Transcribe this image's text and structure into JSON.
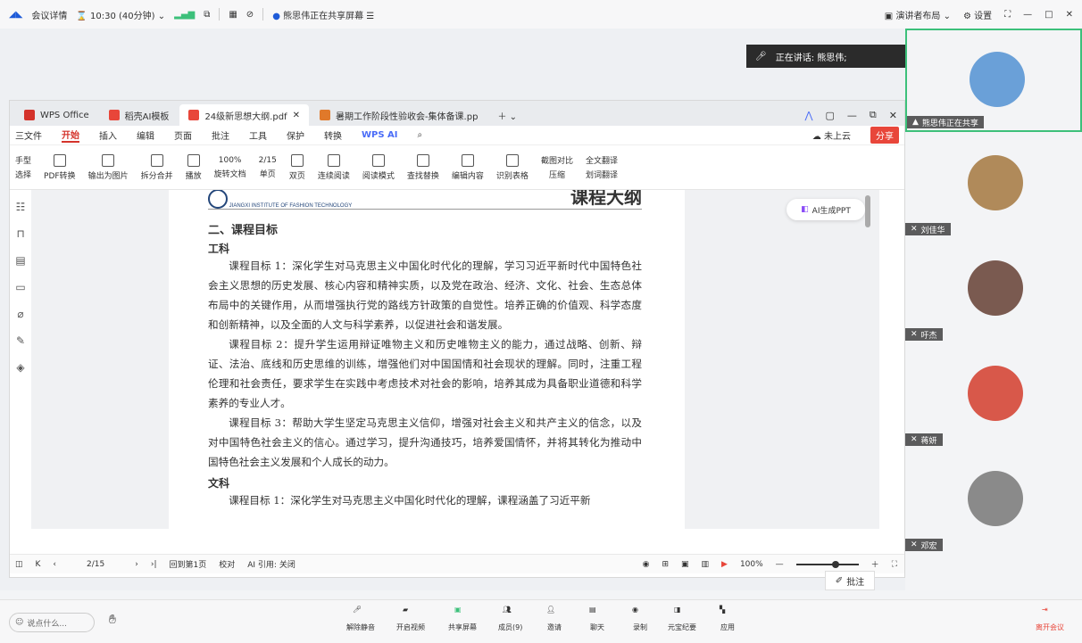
{
  "meeting": {
    "details": "会议详情",
    "time": "10:30 (40分钟)",
    "sharing_status": "熊思伟正在共享屏幕",
    "presenter_layout": "演讲者布局",
    "settings": "设置",
    "speaking_label": "正在讲话: 熊思伟;"
  },
  "wps": {
    "tabs": [
      {
        "label": "WPS Office",
        "color": "#d4332b"
      },
      {
        "label": "稻壳AI模板",
        "color": "#e8463a"
      },
      {
        "label": "24级新思想大纲.pdf",
        "color": "#e8463a"
      },
      {
        "label": "暑期工作阶段性验收会-集体备课.pp",
        "color": "#e0792a"
      }
    ],
    "menu": [
      "三文件",
      "开始",
      "插入",
      "编辑",
      "页面",
      "批注",
      "工具",
      "保护",
      "转换",
      "WPS AI"
    ],
    "menu_active": "开始",
    "not_uploaded": "未上云",
    "share": "分享",
    "toolbar": [
      "手型",
      "选择",
      "PDF转换",
      "输出为图片",
      "拆分合并",
      "播放",
      "旋转文档",
      "单页",
      "双页",
      "连续阅读",
      "阅读模式",
      "查找替换",
      "编辑内容",
      "识别表格",
      "截图对比",
      "压缩",
      "全文翻译",
      "划词翻译"
    ],
    "zoom": "100%",
    "page": "2/15",
    "ai_ppt": "AI生成PPT",
    "status": {
      "page": "2/15",
      "goto": "回到第1页",
      "proof": "校对",
      "ai_cite": "AI 引用: 关闭",
      "zoom": "100%",
      "annotate": "批注"
    }
  },
  "document": {
    "logo_sub": "JIANGXI INSTITUTE OF FASHION TECHNOLOGY",
    "heading": "课程大纲",
    "section": "二、课程目标",
    "sub_gong": "工科",
    "p1": "课程目标 1：深化学生对马克思主义中国化时代化的理解，学习习近平新时代中国特色社会主义思想的历史发展、核心内容和精神实质，以及党在政治、经济、文化、社会、生态总体布局中的关键作用，从而增强执行党的路线方针政策的自觉性。培养正确的价值观、科学态度和创新精神，以及全面的人文与科学素养，以促进社会和谐发展。",
    "p2": "课程目标 2：提升学生运用辩证唯物主义和历史唯物主义的能力，通过战略、创新、辩证、法治、底线和历史思维的训练，增强他们对中国国情和社会现状的理解。同时，注重工程伦理和社会责任，要求学生在实践中考虑技术对社会的影响，培养其成为具备职业道德和科学素养的专业人才。",
    "p3": "课程目标 3：帮助大学生坚定马克思主义信仰，增强对社会主义和共产主义的信念，以及对中国特色社会主义的信心。通过学习，提升沟通技巧，培养爱国情怀，并将其转化为推动中国特色社会主义发展和个人成长的动力。",
    "sub_wen": "文科",
    "p4": "课程目标 1：深化学生对马克思主义中国化时代化的理解，课程涵盖了习近平新"
  },
  "participants": [
    {
      "name": "熊思伟正在共享",
      "color": "#6aa0d8"
    },
    {
      "name": "刘佳华",
      "color": "#b08a5a"
    },
    {
      "name": "吁杰",
      "color": "#7a5a50"
    },
    {
      "name": "蒋妍",
      "color": "#d8584a"
    },
    {
      "name": "邓宏",
      "color": "#8a8a8a"
    }
  ],
  "bottom": {
    "say": "说点什么...",
    "items": [
      "解除静音",
      "开启视频",
      "共享屏幕",
      "成员(9)",
      "邀请",
      "聊天",
      "录制",
      "元宝纪要",
      "应用"
    ],
    "leave": "离开会议"
  }
}
